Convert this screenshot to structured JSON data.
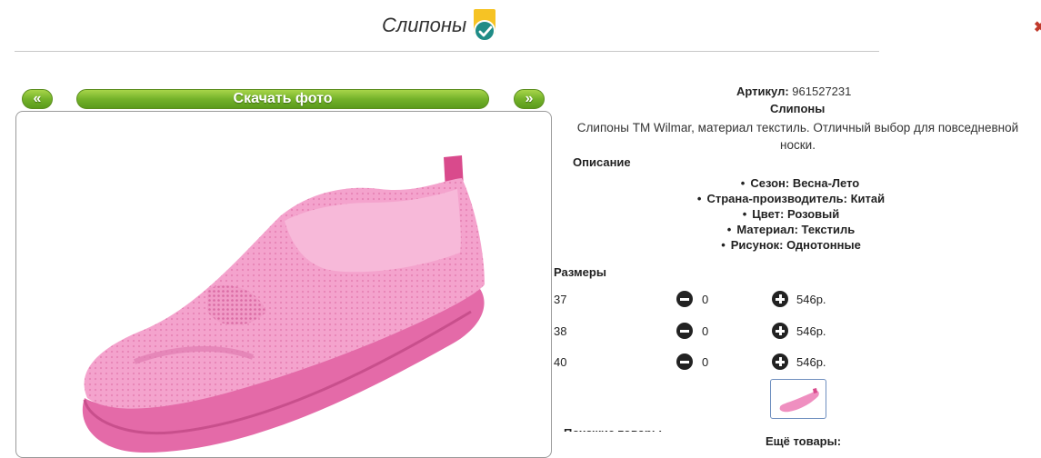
{
  "header": {
    "title": "Слипоны",
    "badge_icon": "verified-check-badge-icon",
    "close_icon": "close-icon"
  },
  "gallery": {
    "prev_label": "«",
    "download_label": "Скачать фото",
    "next_label": "»",
    "shoe_color": "#f29bc6"
  },
  "product": {
    "article_label": "Артикул:",
    "article_value": "961527231",
    "name": "Слипоны",
    "description": "Слипоны ТМ Wilmar, материал текстиль. Отличный выбор для повседневной носки.",
    "description_title": "Описание",
    "properties": [
      "Сезон: Весна-Лето",
      "Страна-производитель: Китай",
      "Цвет: Розовый",
      "Материал: Текстиль",
      "Рисунок: Однотонные"
    ]
  },
  "sizes": {
    "title": "Размеры",
    "rows": [
      {
        "size": "37",
        "qty": "0",
        "price": "546р."
      },
      {
        "size": "38",
        "qty": "0",
        "price": "546р."
      },
      {
        "size": "40",
        "qty": "0",
        "price": "546р."
      }
    ]
  },
  "footer": {
    "similar_label": "Похожие товары",
    "more_label": "Ещё товары:"
  }
}
